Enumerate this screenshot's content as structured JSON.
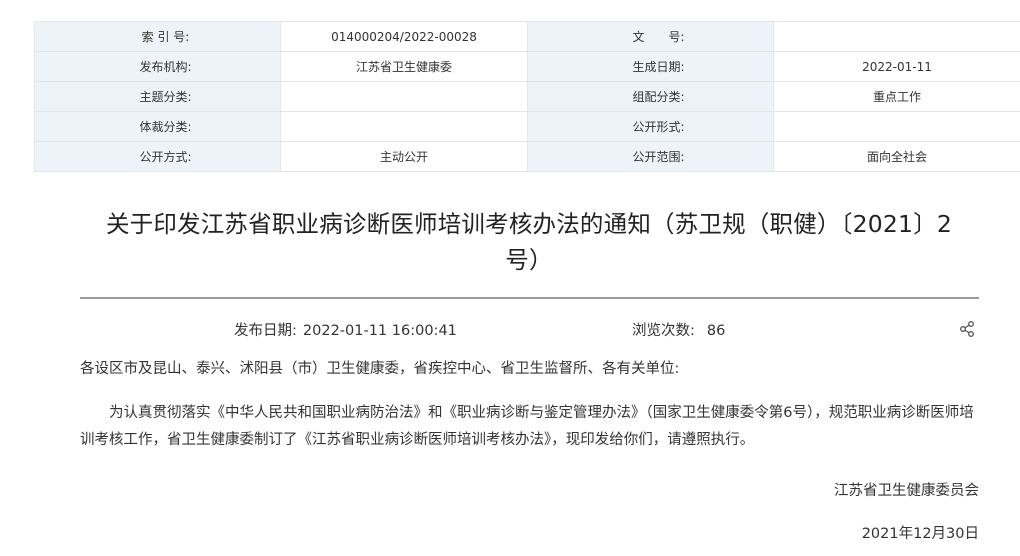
{
  "meta": {
    "rows": [
      [
        {
          "label": "索 引 号:",
          "value": "014000204/2022-00028"
        },
        {
          "label": "文　　号:",
          "value": ""
        }
      ],
      [
        {
          "label": "发布机构:",
          "value": "江苏省卫生健康委"
        },
        {
          "label": "生成日期:",
          "value": "2022-01-11"
        }
      ],
      [
        {
          "label": "主题分类:",
          "value": ""
        },
        {
          "label": "组配分类:",
          "value": "重点工作"
        }
      ],
      [
        {
          "label": "体裁分类:",
          "value": ""
        },
        {
          "label": "公开形式:",
          "value": ""
        }
      ],
      [
        {
          "label": "公开方式:",
          "value": "主动公开"
        },
        {
          "label": "公开范围:",
          "value": "面向全社会"
        }
      ]
    ]
  },
  "article": {
    "title_line1": "关于印发江苏省职业病诊断医师培训考核办法的通知（苏卫规（职健）〔2021〕2",
    "title_line2": "号）",
    "publish_label": "发布日期:",
    "publish_value": "2022-01-11 16:00:41",
    "views_label": "浏览次数:",
    "views_value": "86",
    "addressee": "各设区市及昆山、泰兴、沭阳县（市）卫生健康委，省疾控中心、省卫生监督所、各有关单位:",
    "body": "为认真贯彻落实《中华人民共和国职业病防治法》和《职业病诊断与鉴定管理办法》（国家卫生健康委令第6号），规范职业病诊断医师培训考核工作，省卫生健康委制订了《江苏省职业病诊断医师培训考核办法》，现印发给你们，请遵照执行。",
    "signature": "江苏省卫生健康委员会",
    "signature_date": "2021年12月30日"
  },
  "icons": {
    "share": "share-icon"
  },
  "colors": {
    "label_bg": "#eef3fa",
    "border": "#e2e6ea",
    "text": "#333333",
    "title": "#222222",
    "rule": "#9a9a9a"
  }
}
